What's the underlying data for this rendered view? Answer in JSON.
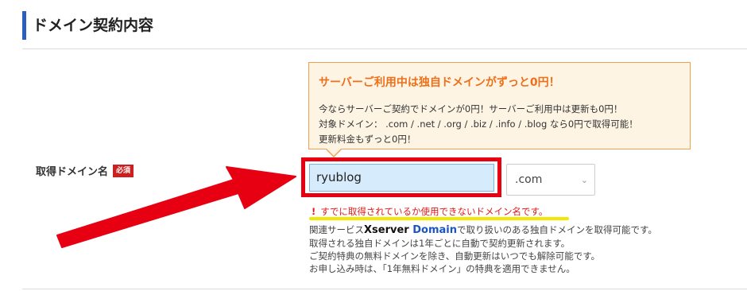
{
  "section": {
    "title": "ドメイン契約内容"
  },
  "promo": {
    "title": "サーバーご利用中は独自ドメインがずっと0円！",
    "lines": [
      "今ならサーバーご契約でドメインが0円！サーバーご利用中は更新も0円！",
      "対象ドメイン： .com / .net / .org / .biz / .info / .blog なら0円で取得可能！",
      "更新料金もずっと0円！"
    ]
  },
  "field": {
    "label": "取得ドメイン名",
    "required_badge": "必須",
    "domain_value": "ryublog",
    "tld_selected": ".com"
  },
  "error": {
    "icon": "!",
    "message": "すでに取得されているか使用できないドメイン名です。"
  },
  "notes": {
    "line1_prefix": "関連サービス",
    "logo_x": "Xserver",
    "logo_domain": "Domain",
    "line1_suffix": "で取り扱いのある独自ドメインを取得可能です。",
    "line2": "取得される独自ドメインは1年ごとに自動で契約更新されます。",
    "line3": "ご契約特典の無料ドメインを除き、自動更新はいつでも解除可能です。",
    "line4": "お申し込み時は、「1年無料ドメイン」の特典を適用できません。"
  },
  "colors": {
    "accent_blue": "#2a5fbf",
    "promo_orange": "#ef6f18",
    "annotation_red": "#e60012",
    "highlight_yellow": "#f3e800"
  }
}
